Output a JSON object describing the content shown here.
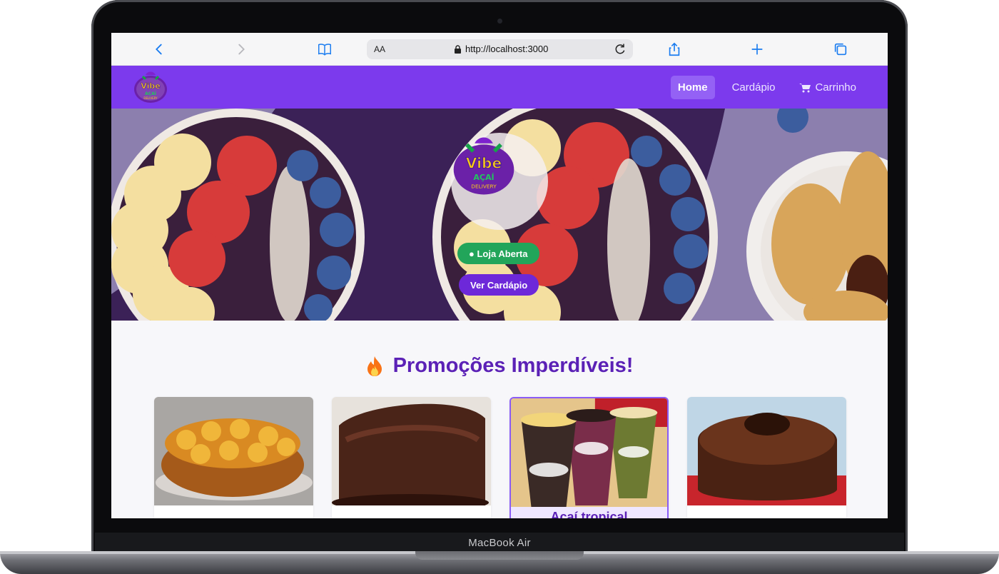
{
  "device_label": "MacBook Air",
  "browser": {
    "aa_label": "AA",
    "url": "http://localhost:3000",
    "icons": [
      "back-icon",
      "forward-icon",
      "bookmarks-icon",
      "lock-icon",
      "reload-icon",
      "share-icon",
      "new-tab-icon",
      "tabs-icon"
    ]
  },
  "nav": {
    "logo_text": "Vibe Açaí Delivery Doces e Salgados",
    "links": [
      {
        "label": "Home",
        "active": true
      },
      {
        "label": "Cardápio",
        "active": false
      },
      {
        "label": "Carrinho",
        "active": false,
        "icon": "cart-icon"
      }
    ]
  },
  "hero": {
    "status_badge": "● Loja Aberta",
    "cta_button": "Ver Cardápio"
  },
  "promotions": {
    "title": "Promoções Imperdíveis!",
    "icon": "fire-icon",
    "cards": [
      {
        "name": "",
        "image": "pineapple-cake"
      },
      {
        "name": "",
        "image": "chocolate-cake"
      },
      {
        "name": "Açaí tropical",
        "image": "acai-cups",
        "highlighted": true
      },
      {
        "name": "",
        "image": "chocolate-bundt-cake"
      }
    ]
  },
  "colors": {
    "primary": "#7c3aed",
    "accent_dark": "#5b21b6",
    "open_green": "#22a55a",
    "browser_blue": "#1a7cf0"
  }
}
